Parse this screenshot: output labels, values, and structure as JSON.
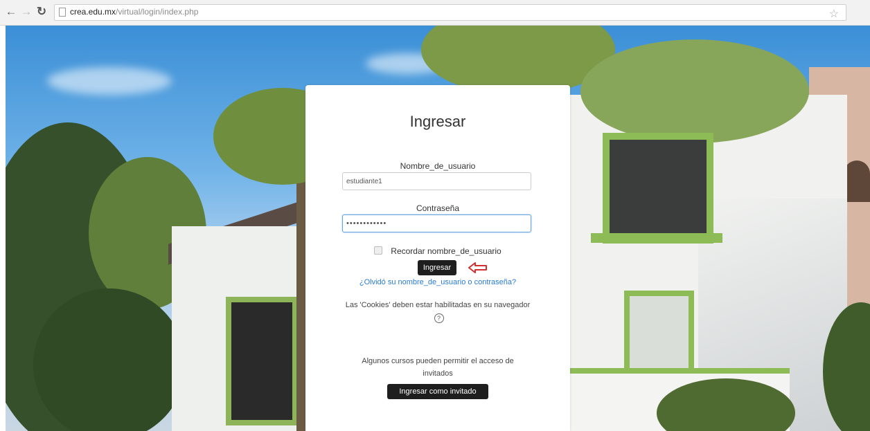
{
  "browser": {
    "url_host": "crea.edu.mx",
    "url_path": "/virtual/login/index.php",
    "icons": [
      "back-icon",
      "forward-icon",
      "reload-icon",
      "page-icon",
      "star-icon"
    ]
  },
  "login": {
    "title": "Ingresar",
    "username_label": "Nombre_de_usuario",
    "username_value": "estudiante1",
    "password_label": "Contraseña",
    "password_value": "••••••••••••",
    "remember_label": "Recordar nombre_de_usuario",
    "login_button": "Ingresar",
    "forgot_link": "¿Olvidó su nombre_de_usuario o contraseña?",
    "cookies_text": "Las 'Cookies' deben estar habilitadas en su navegador",
    "guest_text": "Algunos cursos pueden permitir el acceso de invitados",
    "guest_button": "Ingresar como invitado"
  },
  "colors": {
    "button": "#1e1e1e",
    "link": "#2a7bd1",
    "arrow": "#d32f2f",
    "accent_green": "#8dbb55"
  }
}
